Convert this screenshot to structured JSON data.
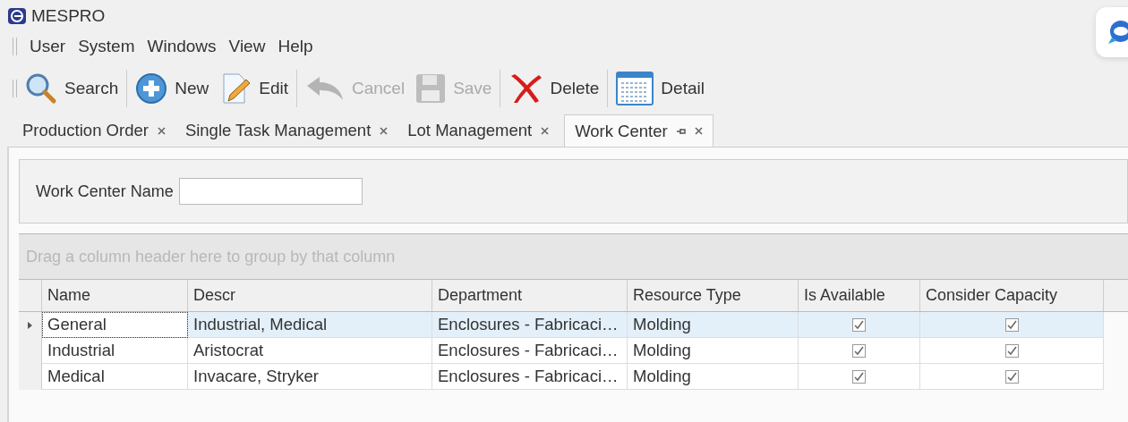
{
  "window": {
    "title": "MESPRO"
  },
  "menu": [
    "User",
    "System",
    "Windows",
    "View",
    "Help"
  ],
  "toolbar": [
    {
      "label": "Search",
      "kind": "search",
      "disabled": false,
      "separator_after": true
    },
    {
      "label": "New",
      "kind": "new",
      "disabled": false,
      "separator_after": false
    },
    {
      "label": "Edit",
      "kind": "edit",
      "disabled": false,
      "separator_after": true
    },
    {
      "label": "Cancel",
      "kind": "cancel",
      "disabled": true,
      "separator_after": false
    },
    {
      "label": "Save",
      "kind": "save",
      "disabled": true,
      "separator_after": true
    },
    {
      "label": "Delete",
      "kind": "delete",
      "disabled": false,
      "separator_after": true
    },
    {
      "label": "Detail",
      "kind": "detail",
      "disabled": false,
      "separator_after": false
    }
  ],
  "tabs": [
    {
      "label": "Production Order",
      "selected": false
    },
    {
      "label": "Single Task Management",
      "selected": false
    },
    {
      "label": "Lot Management",
      "selected": false
    },
    {
      "label": "Work Center",
      "selected": true
    }
  ],
  "filter": {
    "label": "Work Center Name"
  },
  "grid": {
    "group_hint": "Drag a column header here to group by that column",
    "columns": [
      "Name",
      "Descr",
      "Department",
      "Resource Type",
      "Is Available",
      "Consider Capacity"
    ],
    "rows": [
      {
        "selected": true,
        "cells": [
          "General",
          "Industrial, Medical",
          "Enclosures - Fabricaci…",
          "Molding"
        ],
        "is_available": true,
        "consider_capacity": true
      },
      {
        "selected": false,
        "cells": [
          "Industrial",
          "Aristocrat",
          "Enclosures - Fabricaci…",
          "Molding"
        ],
        "is_available": true,
        "consider_capacity": true
      },
      {
        "selected": false,
        "cells": [
          "Medical",
          "Invacare, Stryker",
          "Enclosures - Fabricaci…",
          "Molding"
        ],
        "is_available": true,
        "consider_capacity": true
      }
    ]
  }
}
